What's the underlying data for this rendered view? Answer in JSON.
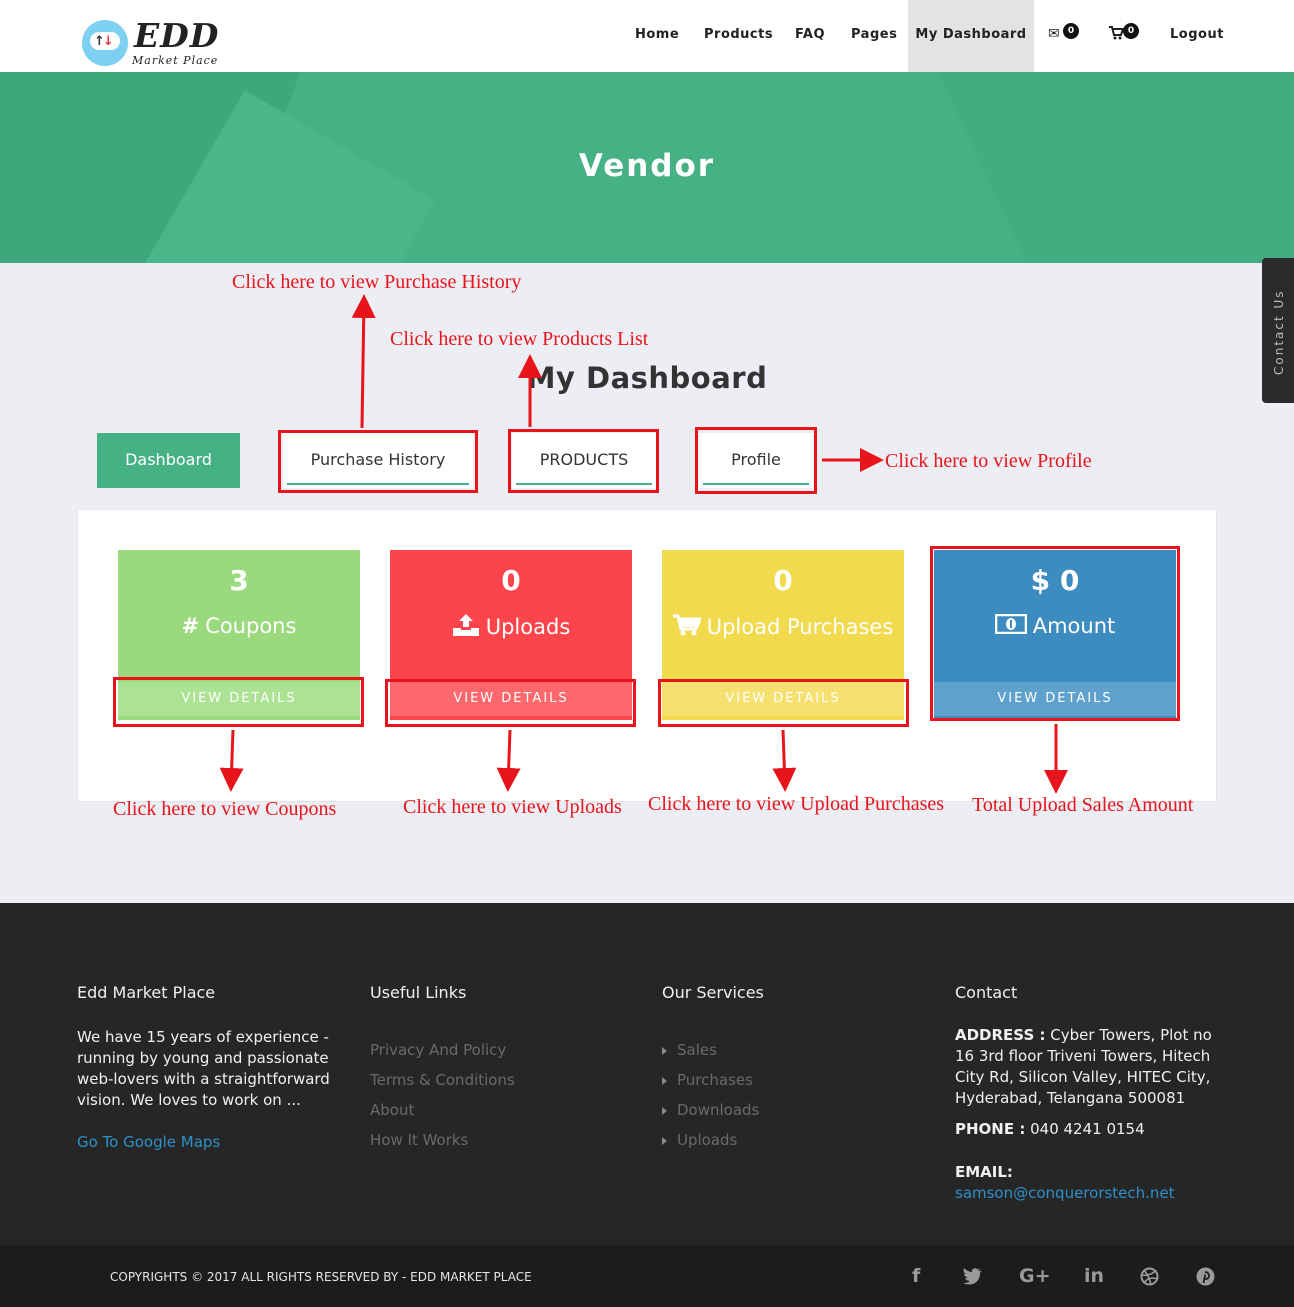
{
  "brand": {
    "title": "EDD",
    "subtitle": "Market Place"
  },
  "nav": {
    "items": [
      "Home",
      "Products",
      "FAQ",
      "Pages",
      "My Dashboard",
      "Logout"
    ],
    "active": "My Dashboard",
    "mail_count": "0",
    "cart_count": "0"
  },
  "hero": {
    "title": "Vendor"
  },
  "contact_tab": "Contact Us",
  "dashboard": {
    "title": "My Dashboard",
    "tabs": [
      "Dashboard",
      "Purchase History",
      "PRODUCTS",
      "Profile"
    ],
    "cards": [
      {
        "value": "3",
        "label": "Coupons",
        "icon": "hash-icon",
        "button": "VIEW DETAILS",
        "color": "#9bd97f",
        "foot_color": "#ace294"
      },
      {
        "value": "0",
        "label": "Uploads",
        "icon": "upload-icon",
        "button": "VIEW DETAILS",
        "color": "#fc444b",
        "foot_color": "#fd686c"
      },
      {
        "value": "0",
        "label": "Upload Purchases",
        "icon": "cart-icon",
        "button": "VIEW DETAILS",
        "color": "#f2da4e",
        "foot_color": "#f5e070"
      },
      {
        "value": "$ 0",
        "label": "Amount",
        "icon": "money-icon",
        "button": "VIEW DETAILS",
        "color": "#3c8cc0",
        "foot_color": "#5fa1cd"
      }
    ]
  },
  "annotations": {
    "purchase_history": "Click here to view Purchase History",
    "products": "Click here to view Products List",
    "profile": "Click here to view Profile",
    "coupons": "Click here to view Coupons",
    "uploads": "Click here to view Uploads",
    "upload_purchases": "Click here to view Upload Purchases",
    "amount": "Total Upload Sales Amount"
  },
  "footer": {
    "about": {
      "title": "Edd Market Place",
      "text": "We have 15 years of experience - running by young and passionate web-lovers with a straightforward vision. We loves to work on ...",
      "maps_link": "Go To Google Maps"
    },
    "useful_links": {
      "title": "Useful Links",
      "items": [
        "Privacy And Policy",
        "Terms & Conditions",
        "About",
        "How It Works"
      ]
    },
    "services": {
      "title": "Our Services",
      "items": [
        "Sales",
        "Purchases",
        "Downloads",
        "Uploads"
      ]
    },
    "contact": {
      "title": "Contact",
      "address_label": "ADDRESS :",
      "address": "Cyber Towers, Plot no 16 3rd floor Triveni Towers, Hitech City Rd, Silicon Valley, HITEC City, Hyderabad, Telangana 500081",
      "phone_label": "PHONE :",
      "phone": "040 4241 0154",
      "email_label": "EMAIL:",
      "email": "samson@conquerorstech.net"
    }
  },
  "copyright": "COPYRIGHTS © 2017 ALL RIGHTS RESERVED BY - EDD MARKET PLACE",
  "social": [
    "facebook-icon",
    "twitter-icon",
    "google-plus-icon",
    "linkedin-icon",
    "dribbble-icon",
    "pinterest-icon"
  ]
}
